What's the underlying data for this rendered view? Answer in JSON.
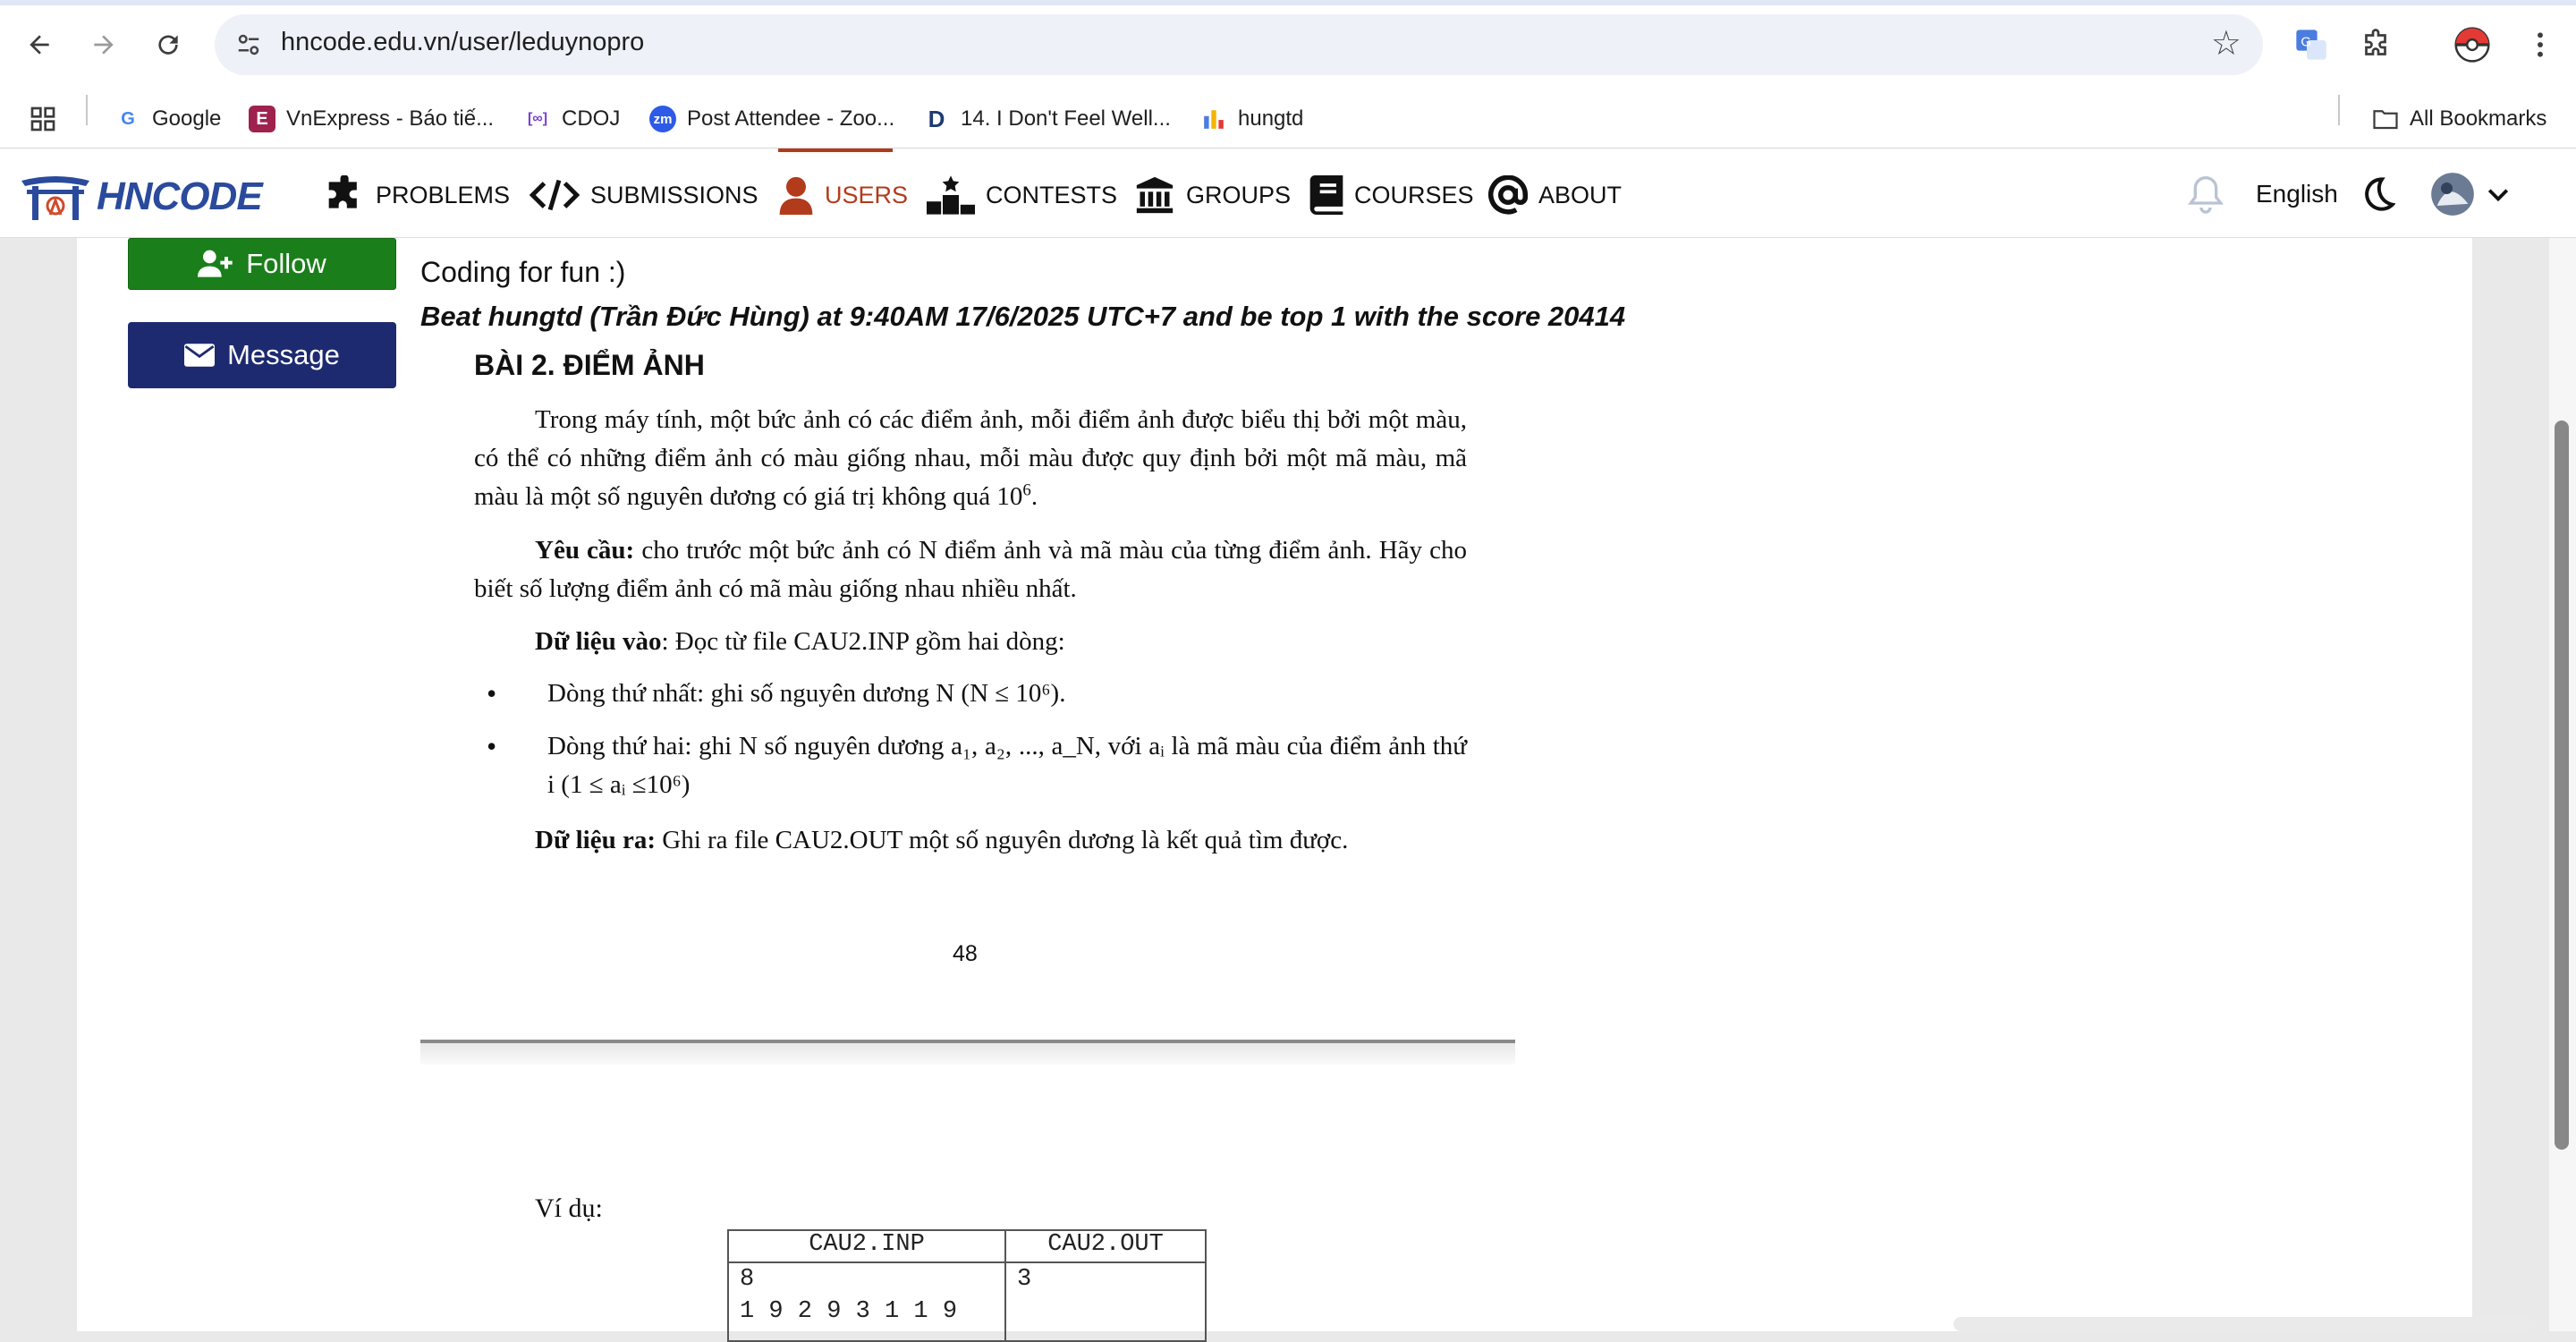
{
  "browser": {
    "url": "hncode.edu.vn/user/leduynopro",
    "bookmarks": [
      {
        "label": "Google"
      },
      {
        "label": "VnExpress - Báo tiế..."
      },
      {
        "label": "CDOJ"
      },
      {
        "label": "Post Attendee - Zoo..."
      },
      {
        "label": "14. I Don't Feel Well..."
      },
      {
        "label": "hungtd"
      }
    ],
    "all_bookmarks": "All Bookmarks"
  },
  "site": {
    "logo": "HNCODE",
    "menu": [
      {
        "label": "PROBLEMS"
      },
      {
        "label": "SUBMISSIONS"
      },
      {
        "label": "USERS"
      },
      {
        "label": "CONTESTS"
      },
      {
        "label": "GROUPS"
      },
      {
        "label": "COURSES"
      },
      {
        "label": "ABOUT"
      }
    ],
    "language": "English",
    "accent_color": "#b23b1b"
  },
  "profile": {
    "follow_label": "Follow",
    "message_label": "Message",
    "bio": "Coding for fun :)",
    "bio_bold": "Beat hungtd (Trần Đức Hùng) at 9:40AM 17/6/2025 UTC+7 and be top 1 with the score 20414"
  },
  "problem": {
    "title": "BÀI 2. ĐIỂM ẢNH",
    "p1": "Trong máy tính, một bức ảnh có các điểm ảnh, mỗi điểm ảnh được biểu thị bởi một màu, có thể có những điểm ảnh có màu giống nhau, mỗi màu được quy định bởi một mã màu, mã màu là một số nguyên dương có giá trị không quá 10",
    "p1_sup": "6",
    "p1_end": ".",
    "req_label": "Yêu cầu:",
    "req_text": " cho trước một bức ảnh có N điểm ảnh và mã màu của từng điểm ảnh. Hãy cho biết số lượng điểm ảnh có mã màu giống nhau nhiều nhất.",
    "input_label": "Dữ liệu vào",
    "input_text": ": Đọc từ file CAU2.INP gồm hai dòng:",
    "bullet1": "Dòng thứ nhất: ghi số nguyên dương N (N ≤ 10⁶).",
    "bullet2": "Dòng thứ hai: ghi N số nguyên dương a₁, a₂, ..., a_N, với aᵢ là mã màu của điểm ảnh thứ i (1 ≤ aᵢ ≤10⁶)",
    "output_label": "Dữ liệu ra:",
    "output_text": " Ghi ra file CAU2.OUT một số nguyên dương là kết quả tìm được.",
    "page_number": "48",
    "example_label": "Ví dụ:",
    "example": {
      "headers": [
        "CAU2.INP",
        "CAU2.OUT"
      ],
      "input": "8\n1 9 2 9 3 1 1 9",
      "output": "3"
    }
  }
}
